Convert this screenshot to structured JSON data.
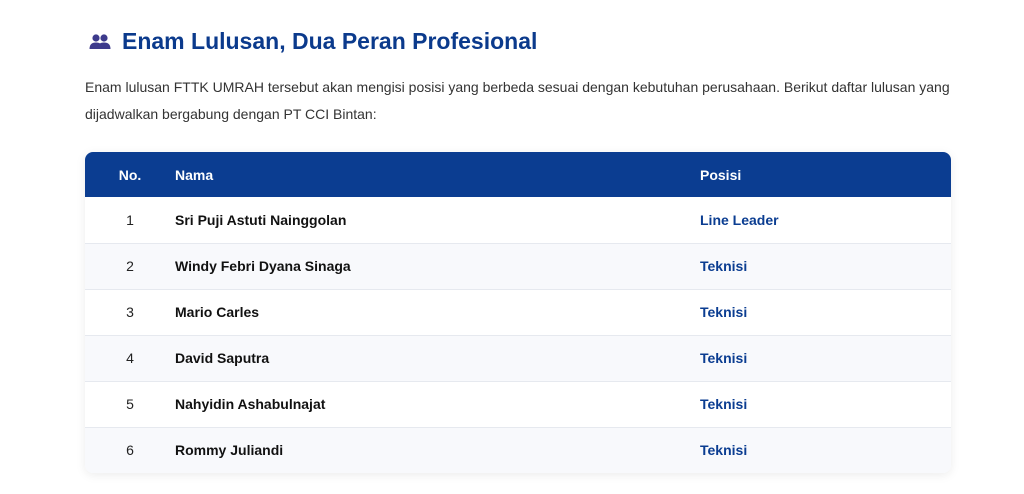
{
  "section": {
    "icon": "people-icon",
    "title": "Enam Lulusan, Dua Peran Profesional",
    "intro": "Enam lulusan FTTK UMRAH tersebut akan mengisi posisi yang berbeda sesuai dengan kebutuhan perusahaan. Berikut daftar lulusan yang dijadwalkan bergabung dengan PT CCI Bintan:"
  },
  "table": {
    "headers": {
      "no": "No.",
      "name": "Nama",
      "position": "Posisi"
    },
    "rows": [
      {
        "no": "1",
        "name": "Sri Puji Astuti Nainggolan",
        "position": "Line Leader"
      },
      {
        "no": "2",
        "name": "Windy Febri Dyana Sinaga",
        "position": "Teknisi"
      },
      {
        "no": "3",
        "name": "Mario Carles",
        "position": "Teknisi"
      },
      {
        "no": "4",
        "name": "David Saputra",
        "position": "Teknisi"
      },
      {
        "no": "5",
        "name": "Nahyidin Ashabulnajat",
        "position": "Teknisi"
      },
      {
        "no": "6",
        "name": "Rommy Juliandi",
        "position": "Teknisi"
      }
    ]
  },
  "colors": {
    "accent": "#0b3d91",
    "icon": "#3d3a8c"
  }
}
